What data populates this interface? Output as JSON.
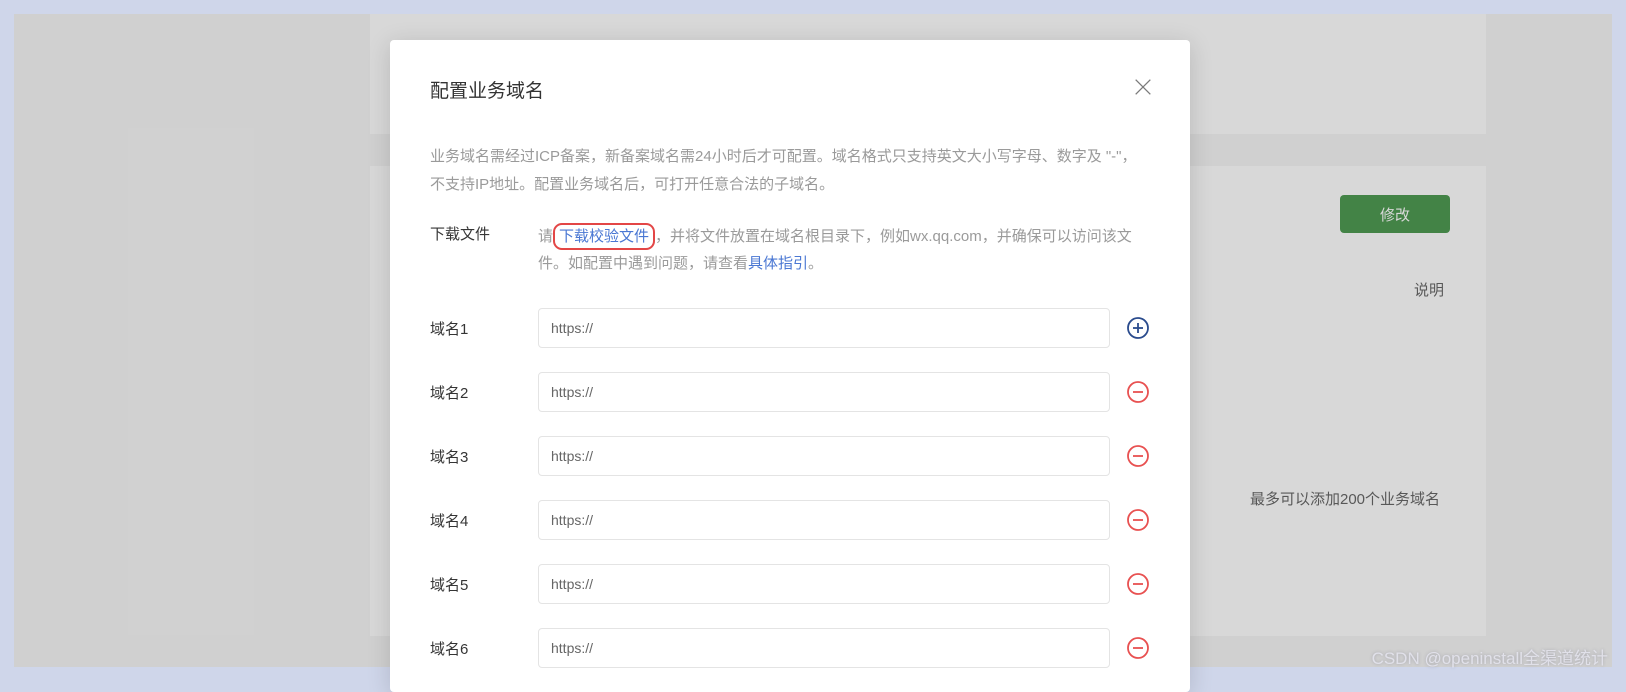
{
  "bg": {
    "modify_label": "修改",
    "desc_label": "说明",
    "max_note": "最多可以添加200个业务域名"
  },
  "modal": {
    "title": "配置业务域名",
    "desc": "业务域名需经过ICP备案，新备案域名需24小时后才可配置。域名格式只支持英文大小写字母、数字及 \"-\"，不支持IP地址。配置业务域名后，可打开任意合法的子域名。",
    "download": {
      "label": "下载文件",
      "prefix": "请",
      "link": "下载校验文件",
      "suffix_before_guide": "，并将文件放置在域名根目录下，例如wx.qq.com，并确保可以访问该文件。如配置中遇到问题，请查看",
      "guide_link": "具体指引",
      "suffix_end": "。"
    },
    "domains": [
      {
        "label": "域名1",
        "value": "https://",
        "action": "add"
      },
      {
        "label": "域名2",
        "value": "https://",
        "action": "remove"
      },
      {
        "label": "域名3",
        "value": "https://",
        "action": "remove"
      },
      {
        "label": "域名4",
        "value": "https://",
        "action": "remove"
      },
      {
        "label": "域名5",
        "value": "https://",
        "action": "remove"
      },
      {
        "label": "域名6",
        "value": "https://",
        "action": "remove"
      }
    ]
  },
  "watermark": "CSDN @openinstall全渠道统计",
  "colors": {
    "add_icon": "#2a4b8d",
    "remove_icon": "#e85151"
  }
}
